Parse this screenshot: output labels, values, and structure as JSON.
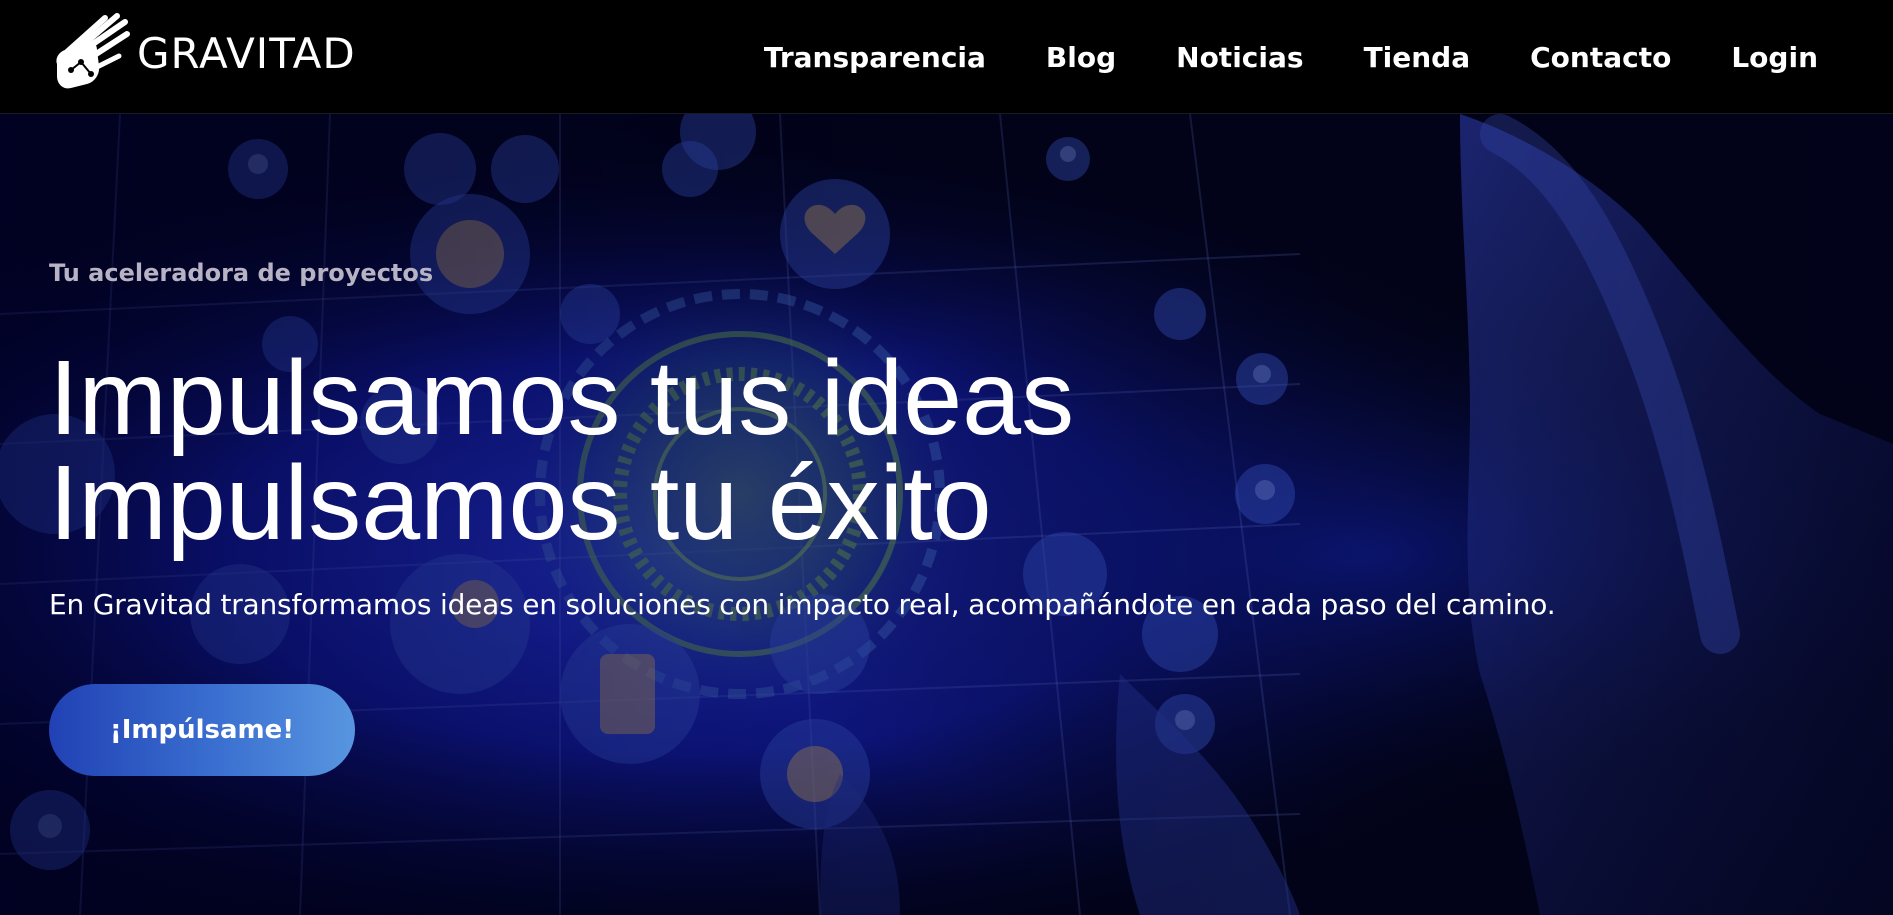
{
  "header": {
    "brand_name": "GRAVITAD",
    "nav": [
      {
        "label": "Transparencia"
      },
      {
        "label": "Blog"
      },
      {
        "label": "Noticias"
      },
      {
        "label": "Tienda"
      },
      {
        "label": "Contacto"
      },
      {
        "label": "Login"
      }
    ]
  },
  "hero": {
    "eyebrow": "Tu aceleradora de proyectos",
    "headline_line1": "Impulsamos tus ideas",
    "headline_line2": "Impulsamos tu éxito",
    "subtext": "En Gravitad transformamos ideas en soluciones con impacto real, acompañándote en cada paso del camino.",
    "cta_label": "¡Impúlsame!"
  },
  "colors": {
    "background": "#000000",
    "nav_text": "#ffffff",
    "eyebrow_text": "#b7b3c4",
    "cta_gradient_start": "#2141b4",
    "cta_gradient_end": "#5896e0",
    "hero_blue": "#1c2fd0"
  }
}
